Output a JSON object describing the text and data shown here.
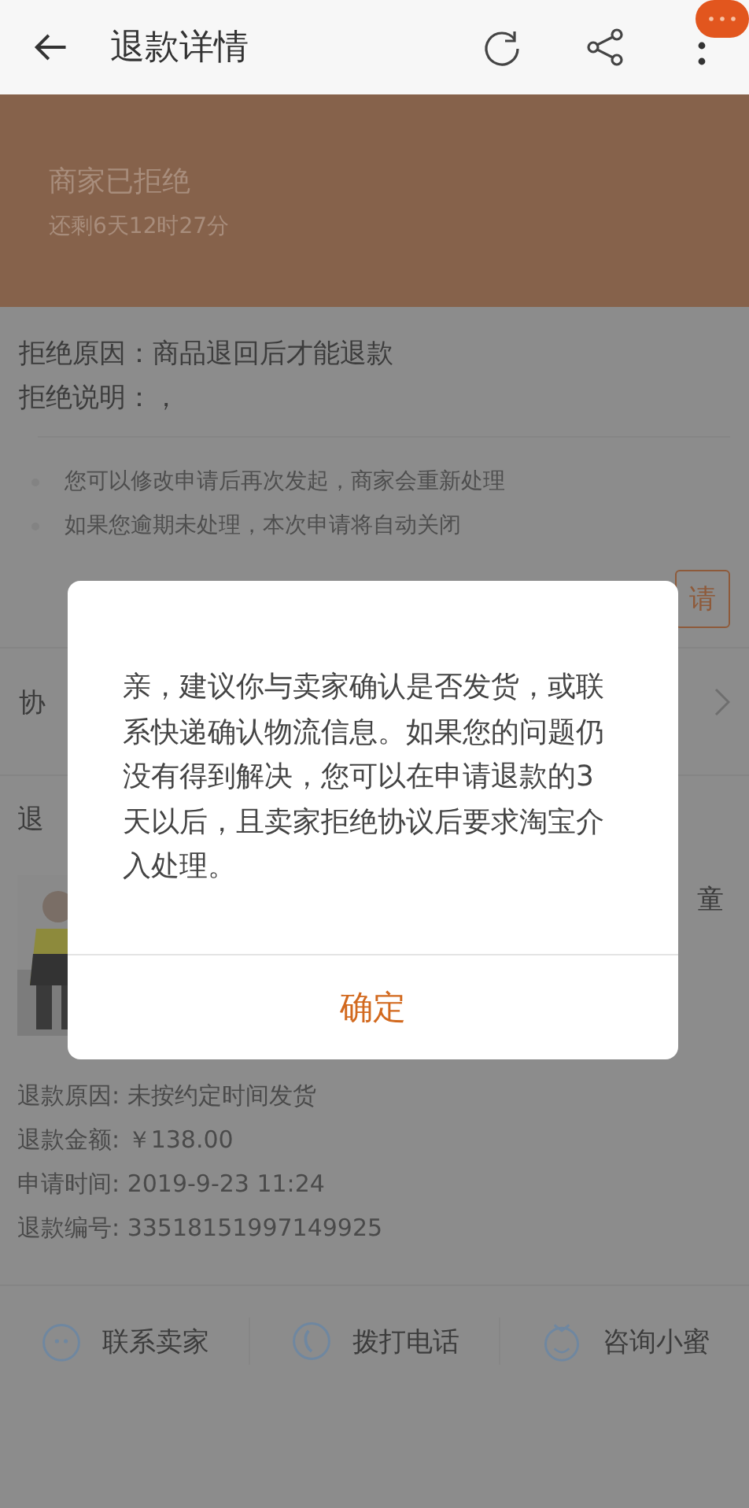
{
  "app_bar": {
    "title": "退款详情"
  },
  "status_banner": {
    "title": "商家已拒绝",
    "countdown": "还剩6天12时27分"
  },
  "rejection": [
    {
      "label": "拒绝原因：",
      "value": "商品退回后才能退款"
    },
    {
      "label": "拒绝说明：",
      "value": "，"
    }
  ],
  "tips": [
    "您可以修改申请后再次发起，商家会重新处理",
    "如果您逾期未处理，本次申请将自动关闭"
  ],
  "action_button": {
    "label": "请"
  },
  "negotiation_row": {
    "label": "协"
  },
  "refund_section": {
    "title": "退",
    "product_name": "童"
  },
  "details": [
    {
      "label": "退款原因:",
      "value": "未按约定时间发货"
    },
    {
      "label": "退款金额:",
      "value": "￥138.00"
    },
    {
      "label": "申请时间:",
      "value": "2019-9-23 11:24"
    },
    {
      "label": "退款编号:",
      "value": "33518151997149925"
    }
  ],
  "bottom_actions": [
    {
      "kind": "chat",
      "label": "联系卖家"
    },
    {
      "kind": "phone",
      "label": "拨打电话"
    },
    {
      "kind": "assistant",
      "label": "咨询小蜜"
    }
  ],
  "dialog": {
    "message": "亲，建议你与卖家确认是否发货，或联系快递确认物流信息。如果您的问题仍没有得到解决，您可以在申请退款的3天以后，且卖家拒绝协议后要求淘宝介入处理。",
    "confirm": "确定"
  }
}
